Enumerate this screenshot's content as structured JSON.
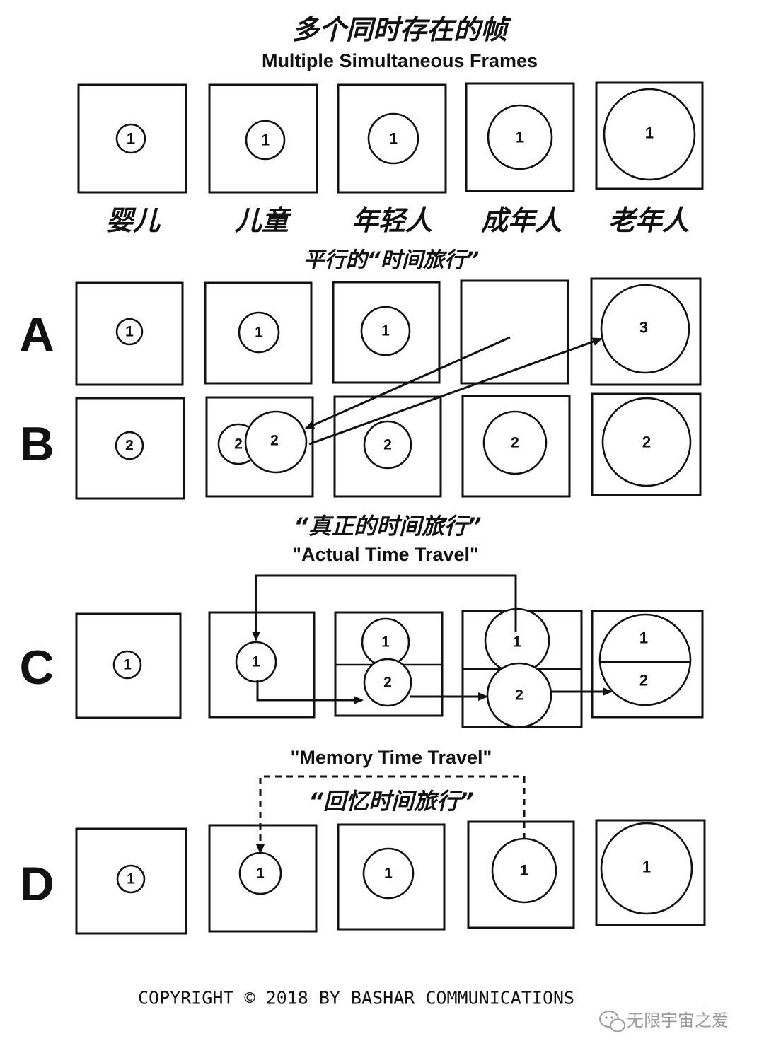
{
  "title_zh": "多个同时存在的帧",
  "title_en": "Multiple Simultaneous Frames",
  "stage_labels": [
    "婴儿",
    "儿童",
    "年轻人",
    "成年人",
    "老年人"
  ],
  "section_parallel": "平行的“时间旅行”",
  "section_actual_zh": "“真正的时间旅行”",
  "section_actual_en": "\"Actual Time Travel\"",
  "section_memory_en": "\"Memory Time Travel\"",
  "section_memory_zh": "“回忆时间旅行”",
  "row_labels": {
    "a": "A",
    "b": "B",
    "c": "C",
    "d": "D"
  },
  "frame_numbers": {
    "top": [
      "1",
      "1",
      "1",
      "1",
      "1"
    ],
    "a": [
      "1",
      "1",
      "1",
      "",
      "3"
    ],
    "b": [
      "2",
      "2",
      "2",
      "2",
      "2",
      "2"
    ],
    "c_upper": [
      "1",
      "1",
      "1",
      "1",
      "1"
    ],
    "c_lower": [
      "2",
      "2",
      "2"
    ],
    "d": [
      "1",
      "1",
      "1",
      "1",
      "1"
    ]
  },
  "copyright": "COPYRIGHT © 2018 BY BASHAR COMMUNICATIONS",
  "watermark": "无限宇宙之爱",
  "colors": {
    "ink": "#111111",
    "paper": "#ffffff",
    "watermark": "#9a9a9a"
  }
}
